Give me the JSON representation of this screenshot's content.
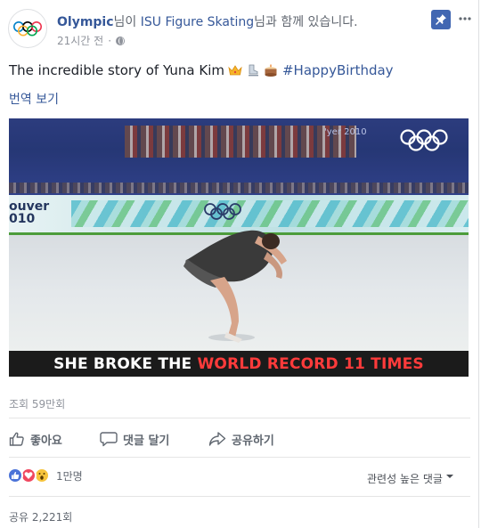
{
  "post": {
    "page_name": "Olympic",
    "with_text_1": "님이 ",
    "tagged_page": "ISU Figure Skating",
    "with_text_2": "님과 함께 있습니다.",
    "time": "21시간 전",
    "dot": "·",
    "text": "The incredible story of Yuna Kim ",
    "emojis": [
      "crown-emoji",
      "ice-skate-emoji",
      "birthday-cake-emoji"
    ],
    "hashtag": "#HappyBirthday",
    "translate_label": "번역 보기"
  },
  "video": {
    "caption_white": "SHE BROKE THE ",
    "caption_red": "WORLD RECORD 11 TIMES",
    "board_text_1": "ouver",
    "board_text_2": "010",
    "stand_text": "'yer 2010",
    "views": "조회 59만회"
  },
  "actions": {
    "like": "좋아요",
    "comment": "댓글 달기",
    "share": "공유하기"
  },
  "footer": {
    "reaction_count": "1만명",
    "sort_label": "관련성 높은 댓글",
    "shares": "공유 2,221회"
  },
  "icons": {
    "pin": "pin-icon",
    "more": "more-icon",
    "globe": "globe-icon",
    "like": "thumbs-up-icon",
    "comment": "comment-bubble-icon",
    "share": "share-arrow-icon"
  },
  "colors": {
    "link": "#365899",
    "accent": "#4267b2",
    "caption_red": "#ff3b3b",
    "muted": "#90949c"
  }
}
